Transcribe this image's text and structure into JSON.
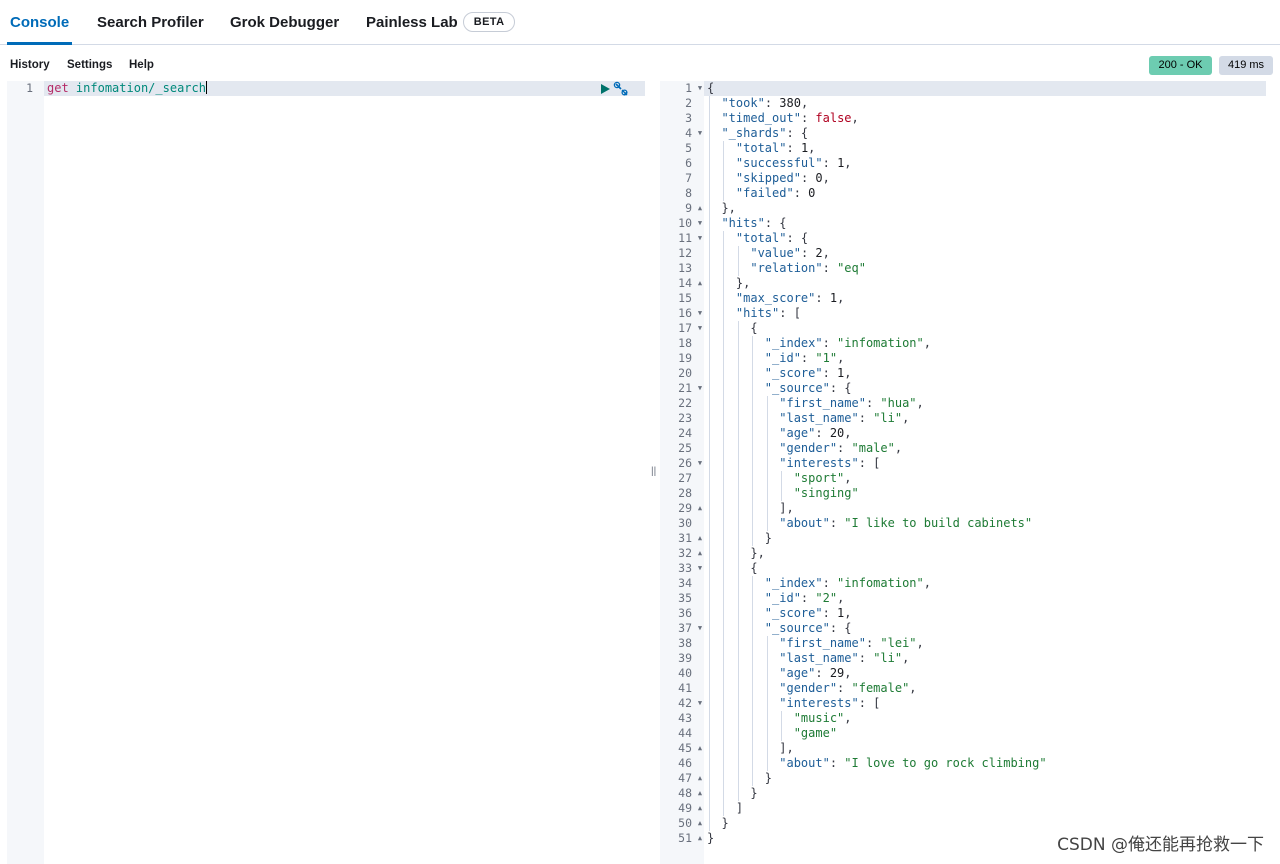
{
  "tabs": [
    {
      "label": "Console"
    },
    {
      "label": "Search Profiler"
    },
    {
      "label": "Grok Debugger"
    },
    {
      "label": "Painless Lab",
      "badge": "BETA"
    }
  ],
  "toolbar": {
    "history": "History",
    "settings": "Settings",
    "help": "Help",
    "status": "200 - OK",
    "time": "419 ms"
  },
  "request": {
    "lines": [
      [
        [
          "get",
          "method"
        ],
        [
          " ",
          "punc"
        ],
        [
          "infomation/_search",
          "url"
        ]
      ]
    ]
  },
  "response": {
    "lines": [
      {
        "fold": "down",
        "t": [
          [
            "{",
            "punc"
          ]
        ]
      },
      {
        "t": [
          [
            "  ",
            "punc"
          ],
          [
            "\"took\"",
            "key"
          ],
          [
            ": ",
            "punc"
          ],
          [
            "380",
            "num"
          ],
          [
            ",",
            "punc"
          ]
        ]
      },
      {
        "t": [
          [
            "  ",
            "punc"
          ],
          [
            "\"timed_out\"",
            "key"
          ],
          [
            ": ",
            "punc"
          ],
          [
            "false",
            "bool"
          ],
          [
            ",",
            "punc"
          ]
        ]
      },
      {
        "fold": "down",
        "t": [
          [
            "  ",
            "punc"
          ],
          [
            "\"_shards\"",
            "key"
          ],
          [
            ": {",
            "punc"
          ]
        ]
      },
      {
        "t": [
          [
            "    ",
            "punc"
          ],
          [
            "\"total\"",
            "key"
          ],
          [
            ": ",
            "punc"
          ],
          [
            "1",
            "num"
          ],
          [
            ",",
            "punc"
          ]
        ]
      },
      {
        "t": [
          [
            "    ",
            "punc"
          ],
          [
            "\"successful\"",
            "key"
          ],
          [
            ": ",
            "punc"
          ],
          [
            "1",
            "num"
          ],
          [
            ",",
            "punc"
          ]
        ]
      },
      {
        "t": [
          [
            "    ",
            "punc"
          ],
          [
            "\"skipped\"",
            "key"
          ],
          [
            ": ",
            "punc"
          ],
          [
            "0",
            "num"
          ],
          [
            ",",
            "punc"
          ]
        ]
      },
      {
        "t": [
          [
            "    ",
            "punc"
          ],
          [
            "\"failed\"",
            "key"
          ],
          [
            ": ",
            "punc"
          ],
          [
            "0",
            "num"
          ]
        ]
      },
      {
        "fold": "up",
        "t": [
          [
            "  },",
            "punc"
          ]
        ]
      },
      {
        "fold": "down",
        "t": [
          [
            "  ",
            "punc"
          ],
          [
            "\"hits\"",
            "key"
          ],
          [
            ": {",
            "punc"
          ]
        ]
      },
      {
        "fold": "down",
        "t": [
          [
            "    ",
            "punc"
          ],
          [
            "\"total\"",
            "key"
          ],
          [
            ": {",
            "punc"
          ]
        ]
      },
      {
        "t": [
          [
            "      ",
            "punc"
          ],
          [
            "\"value\"",
            "key"
          ],
          [
            ": ",
            "punc"
          ],
          [
            "2",
            "num"
          ],
          [
            ",",
            "punc"
          ]
        ]
      },
      {
        "t": [
          [
            "      ",
            "punc"
          ],
          [
            "\"relation\"",
            "key"
          ],
          [
            ": ",
            "punc"
          ],
          [
            "\"eq\"",
            "str"
          ]
        ]
      },
      {
        "fold": "up",
        "t": [
          [
            "    },",
            "punc"
          ]
        ]
      },
      {
        "t": [
          [
            "    ",
            "punc"
          ],
          [
            "\"max_score\"",
            "key"
          ],
          [
            ": ",
            "punc"
          ],
          [
            "1",
            "num"
          ],
          [
            ",",
            "punc"
          ]
        ]
      },
      {
        "fold": "down",
        "t": [
          [
            "    ",
            "punc"
          ],
          [
            "\"hits\"",
            "key"
          ],
          [
            ": [",
            "punc"
          ]
        ]
      },
      {
        "fold": "down",
        "t": [
          [
            "      {",
            "punc"
          ]
        ]
      },
      {
        "t": [
          [
            "        ",
            "punc"
          ],
          [
            "\"_index\"",
            "key"
          ],
          [
            ": ",
            "punc"
          ],
          [
            "\"infomation\"",
            "str"
          ],
          [
            ",",
            "punc"
          ]
        ]
      },
      {
        "t": [
          [
            "        ",
            "punc"
          ],
          [
            "\"_id\"",
            "key"
          ],
          [
            ": ",
            "punc"
          ],
          [
            "\"1\"",
            "str"
          ],
          [
            ",",
            "punc"
          ]
        ]
      },
      {
        "t": [
          [
            "        ",
            "punc"
          ],
          [
            "\"_score\"",
            "key"
          ],
          [
            ": ",
            "punc"
          ],
          [
            "1",
            "num"
          ],
          [
            ",",
            "punc"
          ]
        ]
      },
      {
        "fold": "down",
        "t": [
          [
            "        ",
            "punc"
          ],
          [
            "\"_source\"",
            "key"
          ],
          [
            ": {",
            "punc"
          ]
        ]
      },
      {
        "t": [
          [
            "          ",
            "punc"
          ],
          [
            "\"first_name\"",
            "key"
          ],
          [
            ": ",
            "punc"
          ],
          [
            "\"hua\"",
            "str"
          ],
          [
            ",",
            "punc"
          ]
        ]
      },
      {
        "t": [
          [
            "          ",
            "punc"
          ],
          [
            "\"last_name\"",
            "key"
          ],
          [
            ": ",
            "punc"
          ],
          [
            "\"li\"",
            "str"
          ],
          [
            ",",
            "punc"
          ]
        ]
      },
      {
        "t": [
          [
            "          ",
            "punc"
          ],
          [
            "\"age\"",
            "key"
          ],
          [
            ": ",
            "punc"
          ],
          [
            "20",
            "num"
          ],
          [
            ",",
            "punc"
          ]
        ]
      },
      {
        "t": [
          [
            "          ",
            "punc"
          ],
          [
            "\"gender\"",
            "key"
          ],
          [
            ": ",
            "punc"
          ],
          [
            "\"male\"",
            "str"
          ],
          [
            ",",
            "punc"
          ]
        ]
      },
      {
        "fold": "down",
        "t": [
          [
            "          ",
            "punc"
          ],
          [
            "\"interests\"",
            "key"
          ],
          [
            ": [",
            "punc"
          ]
        ]
      },
      {
        "t": [
          [
            "            ",
            "punc"
          ],
          [
            "\"sport\"",
            "str"
          ],
          [
            ",",
            "punc"
          ]
        ]
      },
      {
        "t": [
          [
            "            ",
            "punc"
          ],
          [
            "\"singing\"",
            "str"
          ]
        ]
      },
      {
        "fold": "up",
        "t": [
          [
            "          ],",
            "punc"
          ]
        ]
      },
      {
        "t": [
          [
            "          ",
            "punc"
          ],
          [
            "\"about\"",
            "key"
          ],
          [
            ": ",
            "punc"
          ],
          [
            "\"I like to build cabinets\"",
            "str"
          ]
        ]
      },
      {
        "fold": "up",
        "t": [
          [
            "        }",
            "punc"
          ]
        ]
      },
      {
        "fold": "up",
        "t": [
          [
            "      },",
            "punc"
          ]
        ]
      },
      {
        "fold": "down",
        "t": [
          [
            "      {",
            "punc"
          ]
        ]
      },
      {
        "t": [
          [
            "        ",
            "punc"
          ],
          [
            "\"_index\"",
            "key"
          ],
          [
            ": ",
            "punc"
          ],
          [
            "\"infomation\"",
            "str"
          ],
          [
            ",",
            "punc"
          ]
        ]
      },
      {
        "t": [
          [
            "        ",
            "punc"
          ],
          [
            "\"_id\"",
            "key"
          ],
          [
            ": ",
            "punc"
          ],
          [
            "\"2\"",
            "str"
          ],
          [
            ",",
            "punc"
          ]
        ]
      },
      {
        "t": [
          [
            "        ",
            "punc"
          ],
          [
            "\"_score\"",
            "key"
          ],
          [
            ": ",
            "punc"
          ],
          [
            "1",
            "num"
          ],
          [
            ",",
            "punc"
          ]
        ]
      },
      {
        "fold": "down",
        "t": [
          [
            "        ",
            "punc"
          ],
          [
            "\"_source\"",
            "key"
          ],
          [
            ": {",
            "punc"
          ]
        ]
      },
      {
        "t": [
          [
            "          ",
            "punc"
          ],
          [
            "\"first_name\"",
            "key"
          ],
          [
            ": ",
            "punc"
          ],
          [
            "\"lei\"",
            "str"
          ],
          [
            ",",
            "punc"
          ]
        ]
      },
      {
        "t": [
          [
            "          ",
            "punc"
          ],
          [
            "\"last_name\"",
            "key"
          ],
          [
            ": ",
            "punc"
          ],
          [
            "\"li\"",
            "str"
          ],
          [
            ",",
            "punc"
          ]
        ]
      },
      {
        "t": [
          [
            "          ",
            "punc"
          ],
          [
            "\"age\"",
            "key"
          ],
          [
            ": ",
            "punc"
          ],
          [
            "29",
            "num"
          ],
          [
            ",",
            "punc"
          ]
        ]
      },
      {
        "t": [
          [
            "          ",
            "punc"
          ],
          [
            "\"gender\"",
            "key"
          ],
          [
            ": ",
            "punc"
          ],
          [
            "\"female\"",
            "str"
          ],
          [
            ",",
            "punc"
          ]
        ]
      },
      {
        "fold": "down",
        "t": [
          [
            "          ",
            "punc"
          ],
          [
            "\"interests\"",
            "key"
          ],
          [
            ": [",
            "punc"
          ]
        ]
      },
      {
        "t": [
          [
            "            ",
            "punc"
          ],
          [
            "\"music\"",
            "str"
          ],
          [
            ",",
            "punc"
          ]
        ]
      },
      {
        "t": [
          [
            "            ",
            "punc"
          ],
          [
            "\"game\"",
            "str"
          ]
        ]
      },
      {
        "fold": "up",
        "t": [
          [
            "          ],",
            "punc"
          ]
        ]
      },
      {
        "t": [
          [
            "          ",
            "punc"
          ],
          [
            "\"about\"",
            "key"
          ],
          [
            ": ",
            "punc"
          ],
          [
            "\"I love to go rock climbing\"",
            "str"
          ]
        ]
      },
      {
        "fold": "up",
        "t": [
          [
            "        }",
            "punc"
          ]
        ]
      },
      {
        "fold": "up",
        "t": [
          [
            "      }",
            "punc"
          ]
        ]
      },
      {
        "fold": "up",
        "t": [
          [
            "    ]",
            "punc"
          ]
        ]
      },
      {
        "fold": "up",
        "t": [
          [
            "  }",
            "punc"
          ]
        ]
      },
      {
        "fold": "up",
        "t": [
          [
            "}",
            "punc"
          ]
        ]
      }
    ]
  },
  "watermark": "CSDN @俺还能再抢救一下",
  "colors": {
    "accent": "#006bb8",
    "status_ok": "#6dccb1",
    "time_badge": "#d3dae6",
    "json_key": "#1d5d97",
    "json_string": "#1e7b35",
    "json_bool": "#b00020",
    "method": "#b52a67"
  }
}
